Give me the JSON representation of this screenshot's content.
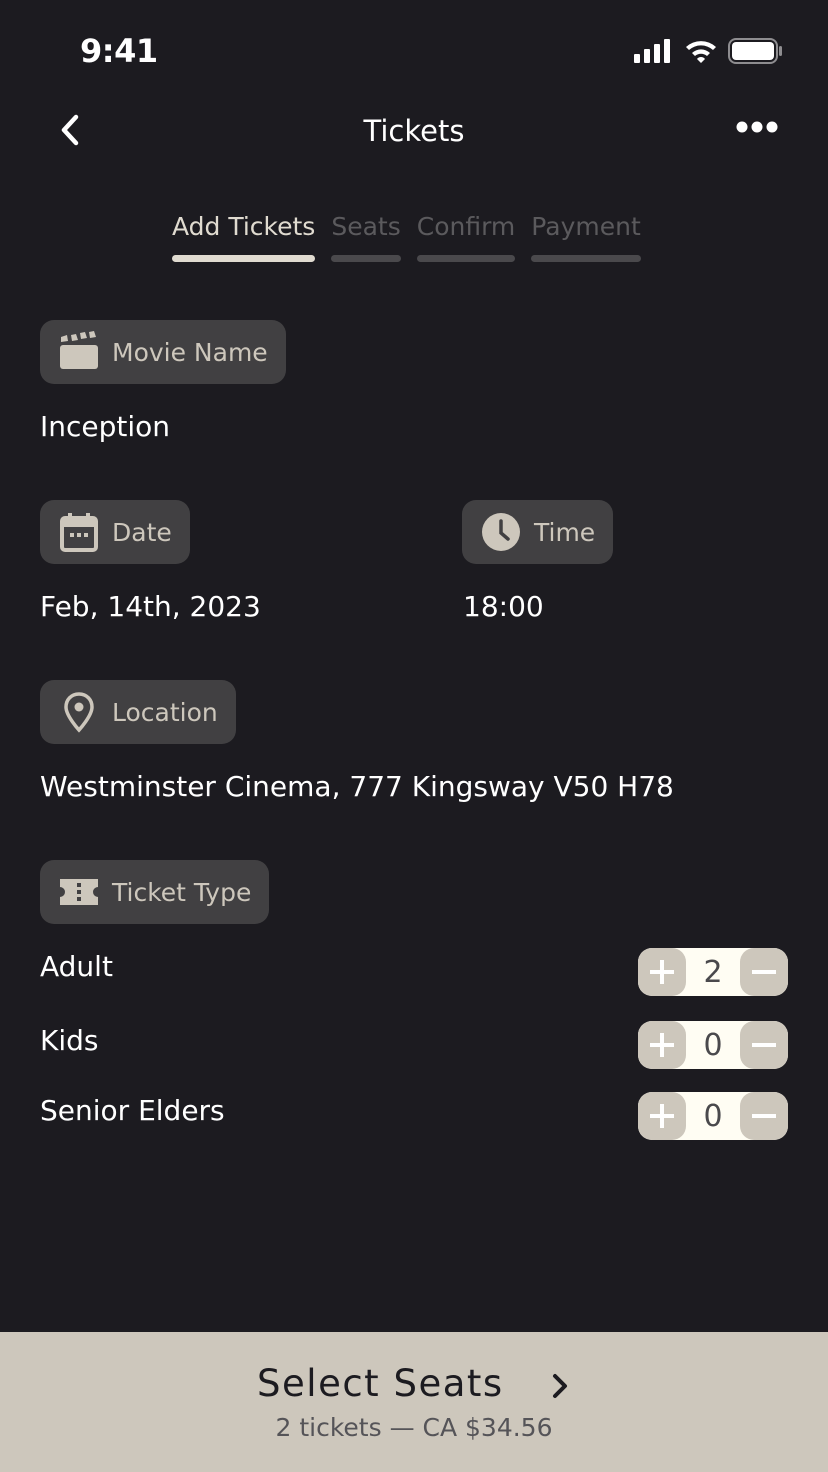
{
  "status_bar": {
    "time": "9:41"
  },
  "header": {
    "title": "Tickets",
    "back_icon": "chevron-left-icon",
    "more_icon": "ellipsis-icon"
  },
  "steps": [
    {
      "label": "Add Tickets",
      "active": true
    },
    {
      "label": "Seats",
      "active": false
    },
    {
      "label": "Confirm",
      "active": false
    },
    {
      "label": "Payment",
      "active": false
    }
  ],
  "movie": {
    "label": "Movie Name",
    "value": "Inception"
  },
  "date": {
    "label": "Date",
    "value": "Feb, 14th, 2023"
  },
  "time": {
    "label": "Time",
    "value": "18:00"
  },
  "location": {
    "label": "Location",
    "value": "Westminster Cinema, 777 Kingsway V50 H78"
  },
  "ticket_type": {
    "label": "Ticket Type",
    "rows": [
      {
        "label": "Adult",
        "count": "2"
      },
      {
        "label": "Kids",
        "count": "0"
      },
      {
        "label": "Senior Elders",
        "count": "0"
      }
    ]
  },
  "footer": {
    "button": "Select Seats",
    "summary": "2 tickets — CA $34.56"
  },
  "colors": {
    "background": "#1c1b20",
    "chip": "#414042",
    "accent": "#cdc7bc"
  }
}
